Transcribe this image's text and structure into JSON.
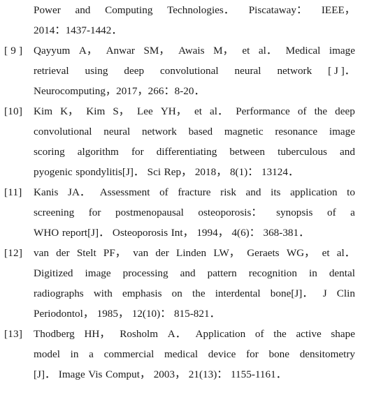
{
  "document": {
    "type": "bibliography",
    "page_background": "#ffffff",
    "text_color": "#1a1a1a",
    "entries": [
      {
        "marker": "",
        "is_continuation": true,
        "lines": [
          {
            "justified": true,
            "words": [
              "Power",
              "and",
              "Computing",
              "Technologies．",
              "Piscataway：",
              "IEEE，"
            ]
          },
          {
            "justified": false,
            "words": [
              "2014：1437-1442．"
            ]
          }
        ]
      },
      {
        "marker": "[ 9 ]",
        "is_continuation": false,
        "lines": [
          {
            "justified": true,
            "words": [
              "Qayyum",
              "A，",
              "Anwar",
              "SM，",
              "Awais",
              "M，",
              "et",
              "al．",
              "Medical",
              "image"
            ]
          },
          {
            "justified": true,
            "words": [
              "retrieval",
              "using",
              "deep",
              "convolutional",
              "neural",
              "network",
              "[ J ]．"
            ]
          },
          {
            "justified": false,
            "words": [
              "Neurocomputing，2017，266：8-20．"
            ]
          }
        ]
      },
      {
        "marker": "[10]",
        "is_continuation": false,
        "lines": [
          {
            "justified": true,
            "words": [
              "Kim",
              "K，",
              "Kim",
              "S，",
              "Lee",
              "YH，",
              "et",
              "al．",
              "Performance",
              "of",
              "the",
              "deep"
            ]
          },
          {
            "justified": true,
            "words": [
              "convolutional",
              "neural",
              "network",
              "based",
              "magnetic",
              "resonance",
              "image"
            ]
          },
          {
            "justified": true,
            "words": [
              "scoring",
              "algorithm",
              "for",
              "differentiating",
              "between",
              "tuberculous",
              "and"
            ]
          },
          {
            "justified": false,
            "words": [
              "pyogenic",
              "spondylitis[J]．",
              "Sci",
              "Rep，",
              "2018，",
              "8(1)：",
              "13124．"
            ]
          }
        ]
      },
      {
        "marker": "[11]",
        "is_continuation": false,
        "lines": [
          {
            "justified": true,
            "words": [
              "Kanis",
              "JA．",
              "Assessment",
              "of",
              "fracture",
              "risk",
              "and",
              "its",
              "application",
              "to"
            ]
          },
          {
            "justified": true,
            "words": [
              "screening",
              "for",
              "postmenopausal",
              "osteoporosis：",
              "synopsis",
              "of",
              "a"
            ]
          },
          {
            "justified": false,
            "words": [
              "WHO",
              "report[J]．",
              "Osteoporosis",
              "Int，",
              "1994，",
              "4(6)：",
              "368-381．"
            ]
          }
        ]
      },
      {
        "marker": "[12]",
        "is_continuation": false,
        "lines": [
          {
            "justified": true,
            "words": [
              "van",
              "der",
              "Stelt",
              "PF，",
              "van",
              "der",
              "Linden",
              "LW，",
              "Geraets",
              "WG，",
              "et",
              "al．"
            ]
          },
          {
            "justified": true,
            "words": [
              "Digitized",
              "image",
              "processing",
              "and",
              "pattern",
              "recognition",
              "in",
              "dental"
            ]
          },
          {
            "justified": true,
            "words": [
              "radiographs",
              "with",
              "emphasis",
              "on",
              "the",
              "interdental",
              "bone[J]．",
              "J",
              "Clin"
            ]
          },
          {
            "justified": false,
            "words": [
              "Periodontol，",
              "1985，",
              "12(10)：",
              "815-821．"
            ]
          }
        ]
      },
      {
        "marker": "[13]",
        "is_continuation": false,
        "lines": [
          {
            "justified": true,
            "words": [
              "Thodberg",
              "HH，",
              "Rosholm",
              "A．",
              "Application",
              "of",
              "the",
              "active",
              "shape"
            ]
          },
          {
            "justified": true,
            "words": [
              "model",
              "in",
              "a",
              "commercial",
              "medical",
              "device",
              "for",
              "bone",
              "densitometry"
            ]
          },
          {
            "justified": false,
            "words": [
              "[J]．",
              "Image",
              "Vis",
              "Comput，",
              "2003，",
              "21(13)：",
              "1155-1161．"
            ]
          }
        ]
      }
    ]
  }
}
